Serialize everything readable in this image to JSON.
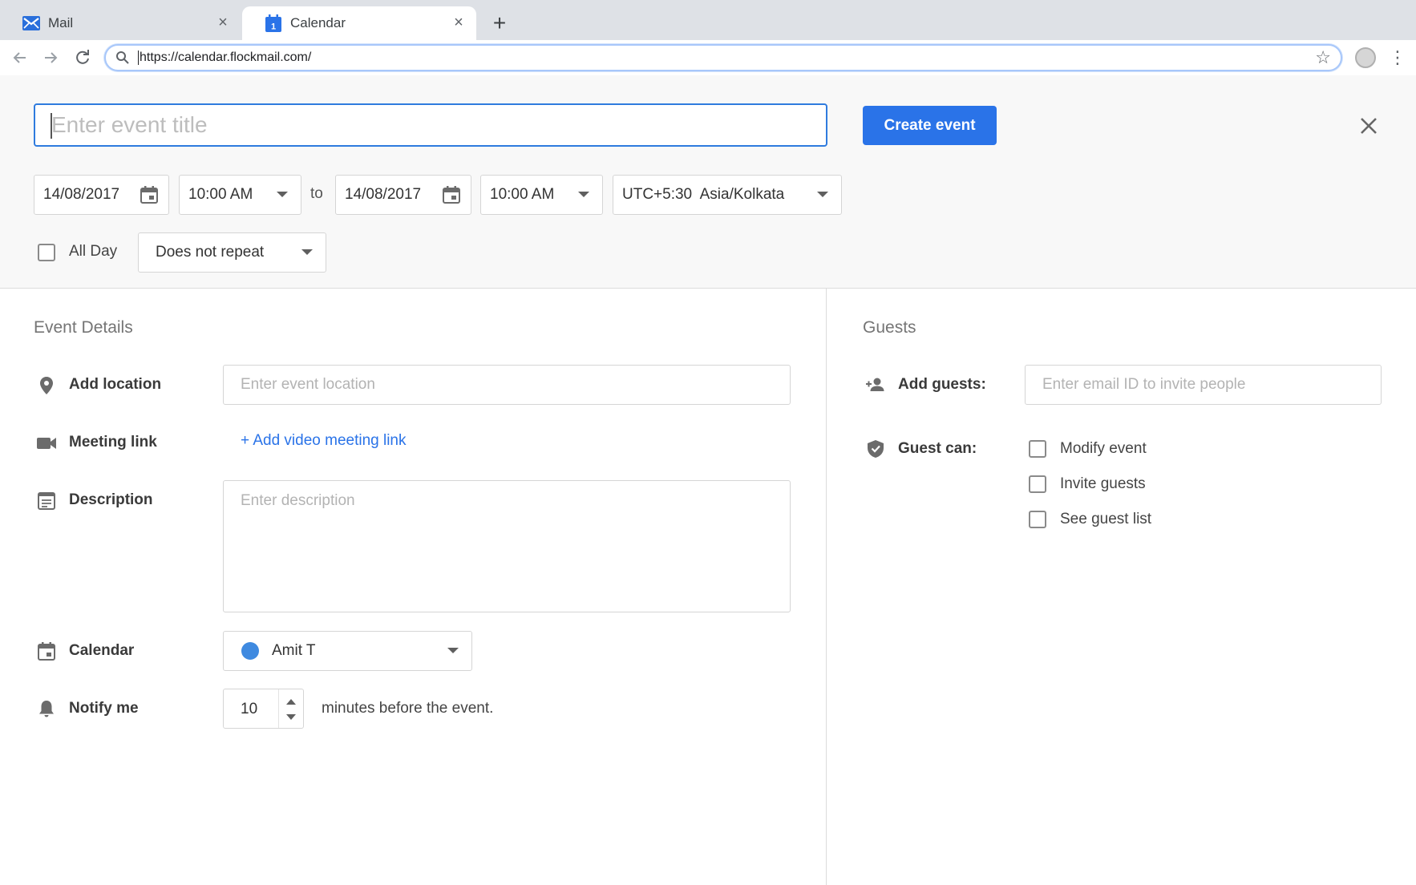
{
  "browser": {
    "tabs": [
      {
        "label": "Mail",
        "icon": "mail-icon",
        "active": false
      },
      {
        "label": "Calendar",
        "icon": "calendar-favicon-icon",
        "active": true
      }
    ],
    "favicon_day": "1",
    "url": "https://calendar.flockmail.com/"
  },
  "header": {
    "title_placeholder": "Enter event title",
    "create_label": "Create event"
  },
  "when": {
    "start_date": "14/08/2017",
    "start_time": "10:00 AM",
    "to_label": "to",
    "end_date": "14/08/2017",
    "end_time": "10:00 AM",
    "timezone": "UTC+5:30  Asia/Kolkata",
    "all_day_label": "All Day",
    "all_day_checked": false,
    "repeat": "Does not repeat"
  },
  "details": {
    "section_title": "Event Details",
    "location_label": "Add location",
    "location_placeholder": "Enter event location",
    "meeting_label": "Meeting link",
    "meeting_link_text": "+ Add video meeting link",
    "description_label": "Description",
    "description_placeholder": "Enter description",
    "calendar_label": "Calendar",
    "calendar_name": "Amit T",
    "calendar_color": "#3f8ae0",
    "notify_label": "Notify me",
    "notify_value": "10",
    "notify_suffix": "minutes before the event."
  },
  "guests": {
    "section_title": "Guests",
    "add_label": "Add guests:",
    "add_placeholder": "Enter email ID to invite people",
    "can_label": "Guest can:",
    "permissions": [
      {
        "label": "Modify event",
        "checked": false
      },
      {
        "label": "Invite guests",
        "checked": false
      },
      {
        "label": "See guest list",
        "checked": false
      }
    ]
  },
  "colors": {
    "accent": "#2a73e8",
    "focus_border": "#2f7bde",
    "panel_bg": "#f8f8f8"
  }
}
